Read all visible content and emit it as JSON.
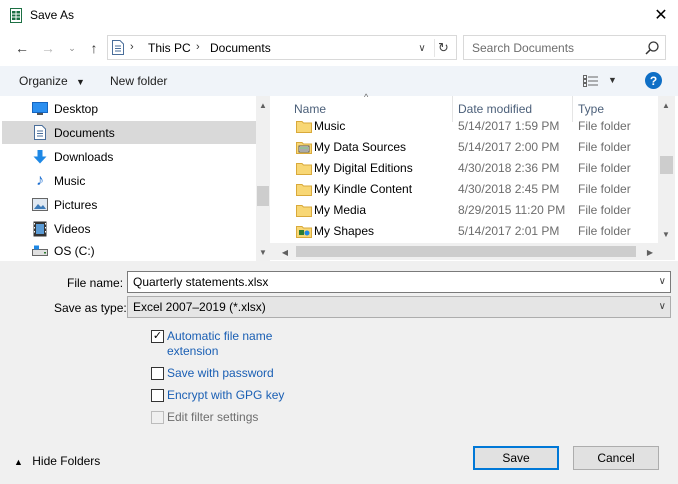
{
  "window": {
    "title": "Save As"
  },
  "address": {
    "crumbs": [
      "This PC",
      "Documents"
    ]
  },
  "search": {
    "placeholder": "Search Documents"
  },
  "toolbar": {
    "organize": "Organize",
    "new_folder": "New folder",
    "help": "?"
  },
  "nav": {
    "items": [
      {
        "label": "Desktop",
        "icon": "desktop-icon"
      },
      {
        "label": "Documents",
        "icon": "documents-icon",
        "selected": true
      },
      {
        "label": "Downloads",
        "icon": "downloads-icon"
      },
      {
        "label": "Music",
        "icon": "music-icon"
      },
      {
        "label": "Pictures",
        "icon": "pictures-icon"
      },
      {
        "label": "Videos",
        "icon": "videos-icon"
      },
      {
        "label": "OS (C:)",
        "icon": "drive-icon"
      }
    ]
  },
  "files": {
    "columns": [
      "Name",
      "Date modified",
      "Type"
    ],
    "rows": [
      {
        "name": "Music",
        "date": "5/14/2017 1:59 PM",
        "type": "File folder",
        "icon": "folder-icon"
      },
      {
        "name": "My Data Sources",
        "date": "5/14/2017 2:00 PM",
        "type": "File folder",
        "icon": "data-sources-folder-icon"
      },
      {
        "name": "My Digital Editions",
        "date": "4/30/2018 2:36 PM",
        "type": "File folder",
        "icon": "folder-icon"
      },
      {
        "name": "My Kindle Content",
        "date": "4/30/2018 2:45 PM",
        "type": "File folder",
        "icon": "folder-icon"
      },
      {
        "name": "My Media",
        "date": "8/29/2015 11:20 PM",
        "type": "File folder",
        "icon": "folder-icon"
      },
      {
        "name": "My Shapes",
        "date": "5/14/2017 2:01 PM",
        "type": "File folder",
        "icon": "shapes-folder-icon"
      }
    ]
  },
  "form": {
    "filename_label": "File name:",
    "filename_value": "Quarterly statements.xlsx",
    "type_label": "Save as type:",
    "type_value": "Excel 2007–2019  (*.xlsx)",
    "options": [
      {
        "label": "Automatic file name extension",
        "checked": true,
        "enabled": true
      },
      {
        "label": "Save with password",
        "checked": false,
        "enabled": true
      },
      {
        "label": "Encrypt with GPG key",
        "checked": false,
        "enabled": true
      },
      {
        "label": "Edit filter settings",
        "checked": false,
        "enabled": false
      }
    ],
    "option_line1": "Automatic file name",
    "option_line2": "extension"
  },
  "footer": {
    "hide_folders": "Hide Folders",
    "save": "Save",
    "cancel": "Cancel"
  },
  "colors": {
    "accent": "#0078d7",
    "link": "#1a5fb4",
    "folder": "#f8d775",
    "selection": "#d9d9d9"
  }
}
